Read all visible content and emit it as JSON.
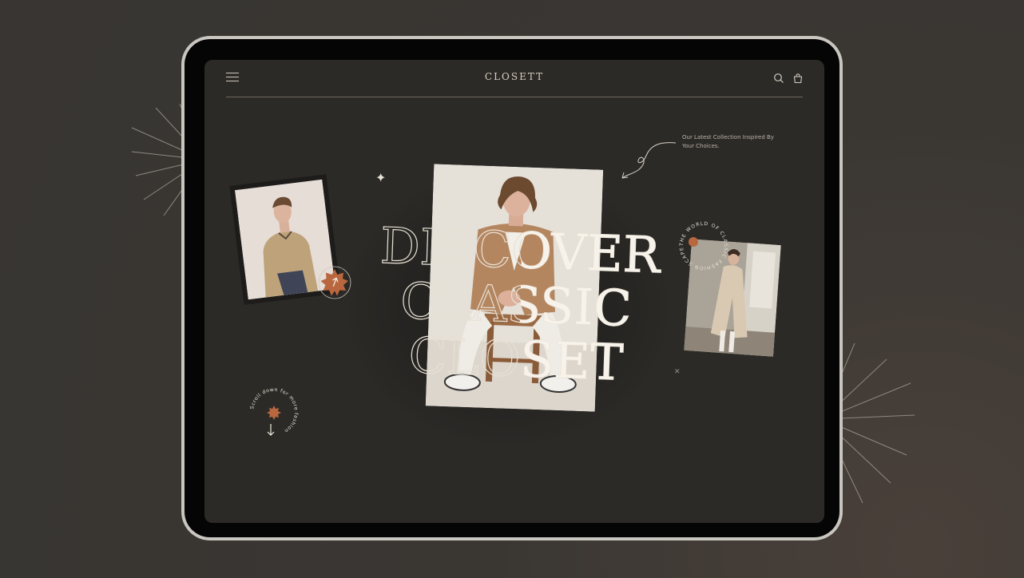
{
  "app": {
    "brand": "CLOSETT",
    "tagline": "Our Latest Collection Inspired By Your Choices."
  },
  "hero": {
    "line1": "DISCOVER",
    "line2": "CLASSIC",
    "line3": "CLOSET"
  },
  "badges": {
    "world_text": "THE WORLD OF CLASSIC FASHION SCAPE IN",
    "scroll_text": "Scroll down for more fashion"
  },
  "icons": {
    "menu": "hamburger-menu-icon",
    "search": "search-icon",
    "bag": "shopping-bag-icon",
    "arrow": "arrow-down-icon"
  },
  "colors": {
    "accent": "#b8673f",
    "background": "#2c2a27",
    "text": "#d8cfc2"
  }
}
